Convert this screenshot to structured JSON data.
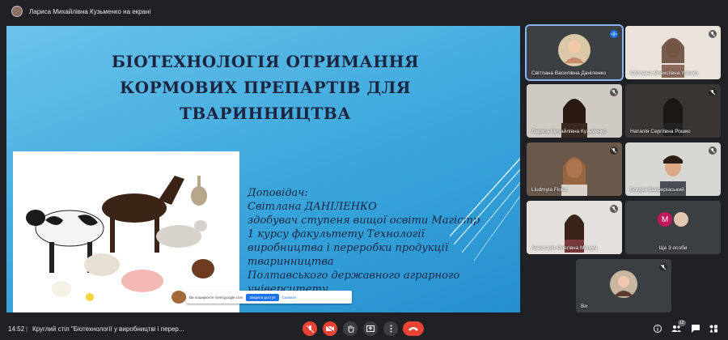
{
  "presentation_bar": {
    "title": "Лариса Михайлівна Кузьменко на екрані"
  },
  "slide": {
    "title_lines": [
      "БІОТЕХНОЛОГІЯ ОТРИМАННЯ",
      "КОРМОВИХ ПРЕПАРТІВ ДЛЯ",
      "ТВАРИННИЦТВА"
    ],
    "speaker_lines": [
      "Доповідач:",
      "Світлана ДАНІЛЕНКО",
      "здобувач ступеня вищої освіти Магістр",
      "1 курсу факультету Технології",
      "виробництва і переробки продукції",
      "тваринництва",
      "Полтавського державного аграрного",
      "університету"
    ]
  },
  "share_toast": {
    "text": "Ви поширюєте meet.google.com",
    "share_button": "Закрити доступ",
    "hide_button": "Сховати"
  },
  "participants": [
    {
      "name": "Світлана Василівна Даніленко",
      "speaking": true,
      "active": true
    },
    {
      "name": "Світлана Олексіївна Усенко",
      "speaking": false
    },
    {
      "name": "Лариса Михайлівна Кузьменко",
      "speaking": false
    },
    {
      "name": "Наталія Сергіївна Рошко",
      "speaking": false
    },
    {
      "name": "Liudmyla Floka",
      "speaking": false
    },
    {
      "name": "Богдан Шаферіаський",
      "speaking": false
    },
    {
      "name": "Анастасія Олегівна Мишун",
      "speaking": false
    },
    {
      "name": "Ще 3 особи",
      "avatar_letter": "M",
      "speaking": false
    },
    {
      "name": "Ви",
      "speaking": false
    }
  ],
  "bottom_bar": {
    "time": "14:52",
    "separator": "|",
    "meeting_title": "Круглий стіл \"Біотехнології у виробництві і перер...",
    "people_badge": "12"
  },
  "colors": {
    "accent": "#8ab4f8",
    "red": "#ea4335",
    "bg": "#202124"
  }
}
